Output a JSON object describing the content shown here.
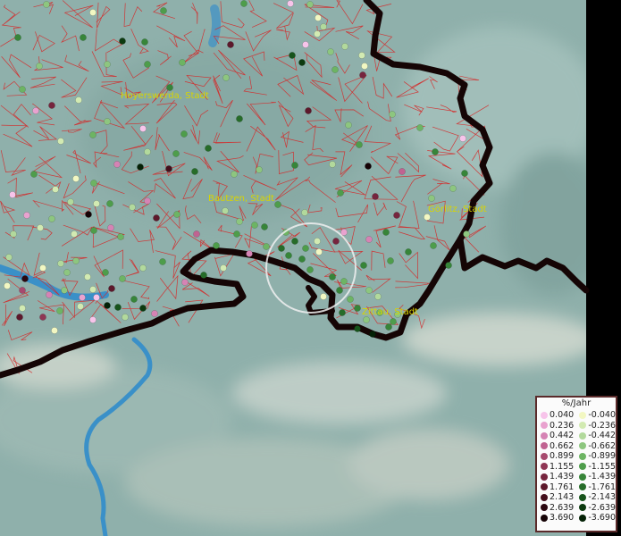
{
  "cities": [
    {
      "name": "Hoyerswerda, Stadt"
    },
    {
      "name": "Bautzen, Stadt"
    },
    {
      "name": "Görlitz, Stadt"
    },
    {
      "name": "Zittau, Stadt"
    }
  ],
  "legend": {
    "title": "%/Jahr",
    "positive": [
      {
        "label": "0.040",
        "color": "#f7c4ea"
      },
      {
        "label": "0.236",
        "color": "#e9a2cf"
      },
      {
        "label": "0.442",
        "color": "#d583b4"
      },
      {
        "label": "0.662",
        "color": "#c06391"
      },
      {
        "label": "0.899",
        "color": "#a74a6e"
      },
      {
        "label": "1.155",
        "color": "#8f3654"
      },
      {
        "label": "1.439",
        "color": "#76253e"
      },
      {
        "label": "1.761",
        "color": "#5d182b"
      },
      {
        "label": "2.143",
        "color": "#430e1b"
      },
      {
        "label": "2.639",
        "color": "#2b060f"
      },
      {
        "label": "3.690",
        "color": "#150205"
      }
    ],
    "negative": [
      {
        "label": "-0.040",
        "color": "#f2f7c2"
      },
      {
        "label": "-0.236",
        "color": "#d2eab2"
      },
      {
        "label": "-0.442",
        "color": "#b2d99c"
      },
      {
        "label": "-0.662",
        "color": "#8dc67f"
      },
      {
        "label": "-0.899",
        "color": "#6db463"
      },
      {
        "label": "-1.155",
        "color": "#4e9d4b"
      },
      {
        "label": "-1.439",
        "color": "#378539"
      },
      {
        "label": "-1.761",
        "color": "#266c29"
      },
      {
        "label": "-2.143",
        "color": "#17531b"
      },
      {
        "label": "-2.639",
        "color": "#0c3a0f"
      },
      {
        "label": "-3.690",
        "color": "#042106"
      }
    ]
  },
  "colors": {
    "terrain": "#8fb0ab",
    "district_lines": "#d42a2a",
    "border": "#150505",
    "river": "#3a90c8",
    "city_label": "#d8d400"
  }
}
